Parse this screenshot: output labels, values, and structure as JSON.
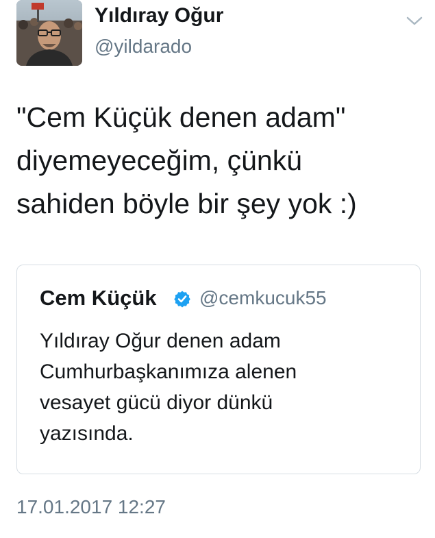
{
  "author": {
    "display_name": "Yıldıray Oğur",
    "handle": "@yildarado",
    "avatar_icon": "user-avatar-photo"
  },
  "menu": {
    "icon": "chevron-down-icon"
  },
  "tweet": {
    "lines": [
      "\"Cem Küçük denen adam\"",
      "diyemeyeceğim, çünkü",
      "sahiden böyle bir şey yok :)"
    ],
    "timestamp": "17.01.2017 12:27"
  },
  "quoted_tweet": {
    "display_name": "Cem Küçük",
    "verified": true,
    "verified_color": "#1da1f2",
    "handle": "@cemkucuk55",
    "lines": [
      "Yıldıray Oğur denen adam",
      "Cumhurbaşkanımıza alenen",
      "vesayet gücü diyor dünkü",
      "yazısında."
    ]
  },
  "colors": {
    "text_primary": "#14171a",
    "text_secondary": "#657786",
    "border": "#d6dde3"
  }
}
